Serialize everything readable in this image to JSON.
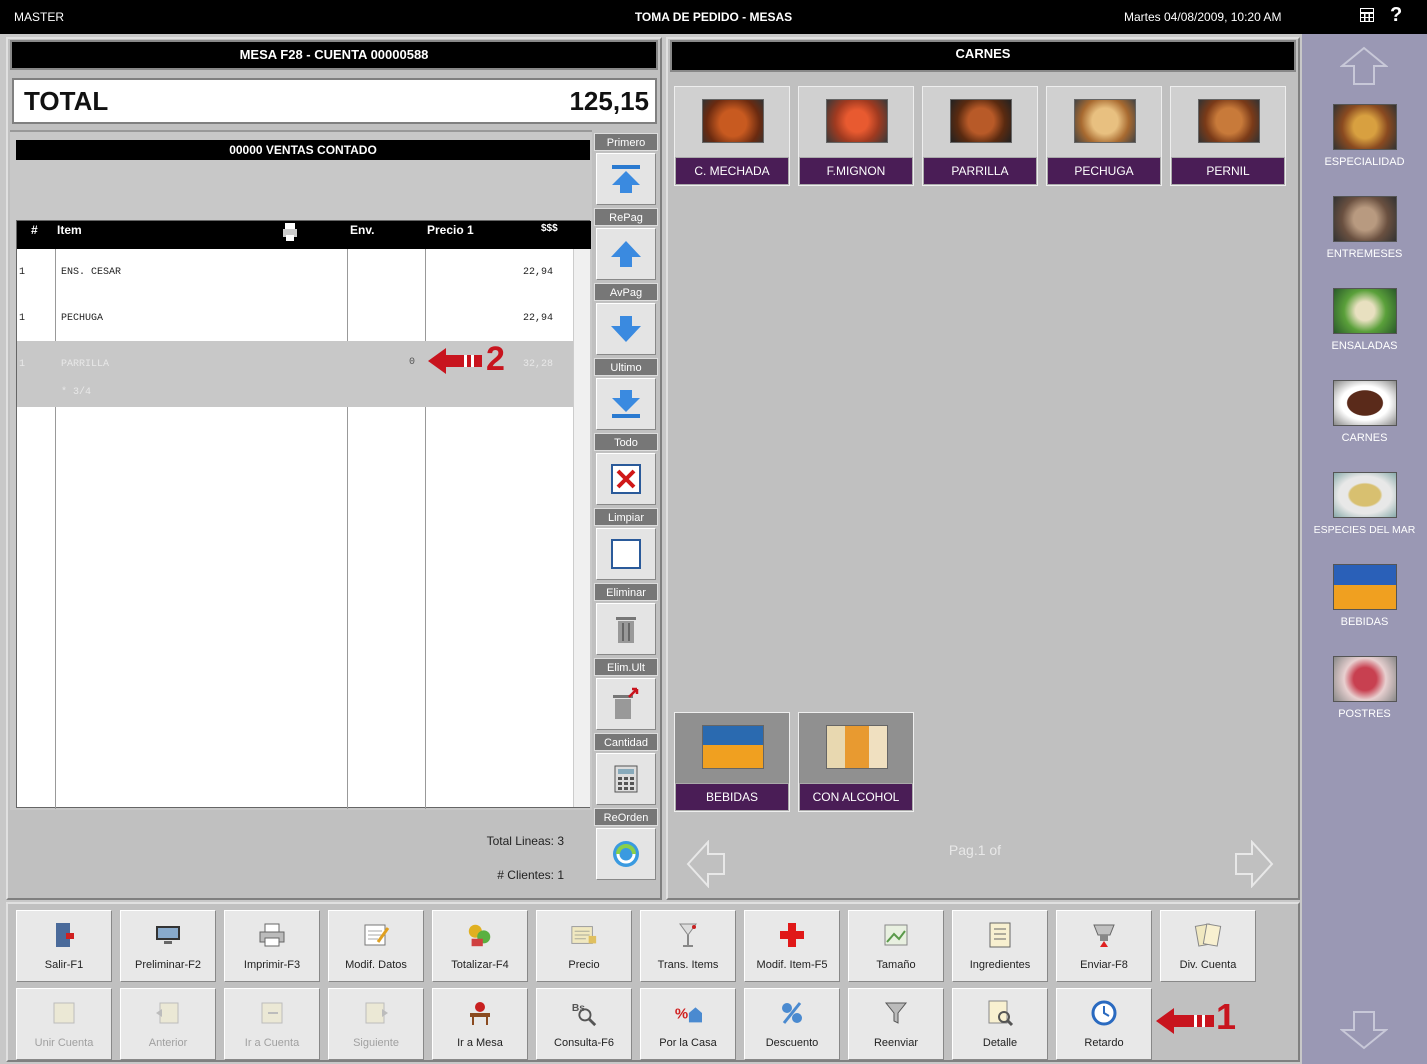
{
  "topbar": {
    "user": "MASTER",
    "title": "TOMA DE PEDIDO - MESAS",
    "datetime": "Martes 04/08/2009, 10:20 AM",
    "help": "?"
  },
  "order": {
    "header": "MESA F28 - CUENTA 00000588",
    "total_label": "TOTAL",
    "total_value": "125,15",
    "client_bar": "00000 VENTAS CONTADO",
    "columns": {
      "num": "#",
      "item": "Item",
      "env": "Env.",
      "price": "Precio 1",
      "extra": "$$$"
    },
    "rows": [
      {
        "qty": "1",
        "item": "ENS. CESAR",
        "env": "",
        "price": "22,94"
      },
      {
        "qty": "1",
        "item": "PECHUGA",
        "env": "",
        "price": "22,94"
      },
      {
        "qty": "1",
        "item": "PARRILLA",
        "env": "0",
        "price": "32,28",
        "sub": "* 3/4"
      }
    ],
    "annotation_2": "2",
    "total_lines": "Total Lineas: 3",
    "clients": "# Clientes: 1"
  },
  "nav": [
    "Primero",
    "RePag",
    "AvPag",
    "Ultimo",
    "Todo",
    "Limpiar",
    "Eliminar",
    "Elim.Ult",
    "Cantidad",
    "ReOrden"
  ],
  "menu": {
    "header": "CARNES",
    "items": [
      {
        "label": "C. MECHADA",
        "color": "#8a4a1a"
      },
      {
        "label": "F.MIGNON",
        "color": "#a8442a"
      },
      {
        "label": "PARRILLA",
        "color": "#7a3a20"
      },
      {
        "label": "PECHUGA",
        "color": "#b88a50"
      },
      {
        "label": "PERNIL",
        "color": "#9a5a2a"
      }
    ],
    "subitems": [
      {
        "label": "BEBIDAS",
        "color": "#2a6ab0"
      },
      {
        "label": "CON ALCOHOL",
        "color": "#c89040"
      }
    ],
    "pager": "Pag.1 of"
  },
  "categories": [
    {
      "label": "ESPECIALIDAD",
      "color": "#8a5a2a"
    },
    {
      "label": "ENTREMESES",
      "color": "#6a5040"
    },
    {
      "label": "ENSALADAS",
      "color": "#4a8a3a"
    },
    {
      "label": "CARNES",
      "color": "#5a2a1a"
    },
    {
      "label": "ESPECIES DEL MAR",
      "color": "#c8b060"
    },
    {
      "label": "BEBIDAS",
      "color": "#2a60b8"
    },
    {
      "label": "POSTRES",
      "color": "#c84050"
    }
  ],
  "functions_row1": [
    "Salir-F1",
    "Preliminar-F2",
    "Imprimir-F3",
    "Modif. Datos",
    "Totalizar-F4",
    "Precio",
    "Trans. Items",
    "Modif. Item-F5",
    "Tamaño",
    "Ingredientes",
    "Enviar-F8",
    "Div. Cuenta"
  ],
  "functions_row2": [
    "Unir Cuenta",
    "Anterior",
    "Ir a Cuenta",
    "Siguiente",
    "Ir a Mesa",
    "Consulta-F6",
    "Por la Casa",
    "Descuento",
    "Reenviar",
    "Detalle",
    "Retardo"
  ],
  "annotation_1": "1",
  "colors": {
    "accent": "#4a1d56",
    "arrow": "#c8141e",
    "highlight": "#c8c8c8"
  }
}
